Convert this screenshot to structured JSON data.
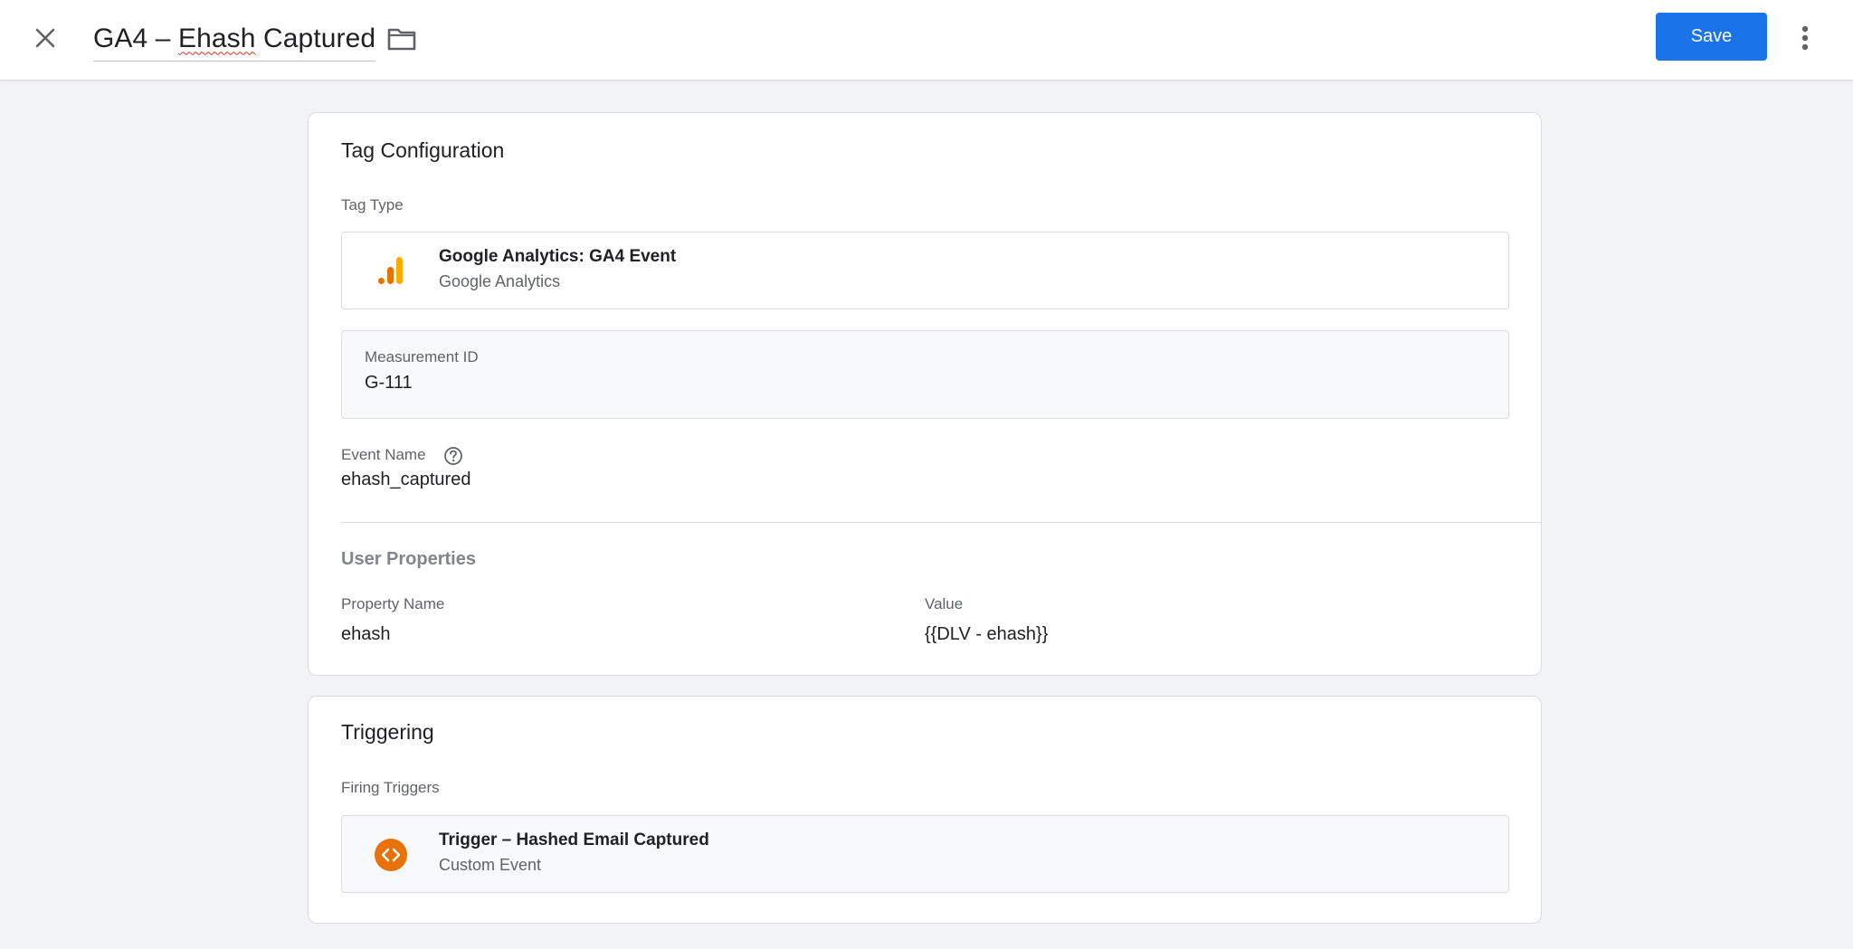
{
  "header": {
    "title_prefix": "GA4 – ",
    "title_misspelled": "Ehash",
    "title_suffix": " Captured",
    "save_label": "Save",
    "icons": [
      "close-icon",
      "folder-icon",
      "more-vert-icon"
    ],
    "accent_color": "#1a73e8"
  },
  "tag_configuration": {
    "title": "Tag Configuration",
    "tag_type_label": "Tag Type",
    "tag_type": {
      "name": "Google Analytics: GA4 Event",
      "provider": "Google Analytics",
      "icon": "google-analytics-icon"
    },
    "measurement_id": {
      "label": "Measurement ID",
      "value": "G-111"
    },
    "event_name": {
      "label": "Event Name",
      "value": "ehash_captured",
      "help_icon": "help-icon"
    },
    "user_properties": {
      "title": "User Properties",
      "property_name_label": "Property Name",
      "value_label": "Value",
      "rows": [
        {
          "property_name": "ehash",
          "value": "{{DLV - ehash}}"
        }
      ]
    }
  },
  "triggering": {
    "title": "Triggering",
    "firing_triggers_label": "Firing Triggers",
    "triggers": [
      {
        "name": "Trigger – Hashed Email Captured",
        "type": "Custom Event",
        "icon": "custom-event-icon",
        "icon_color": "#e8710a"
      }
    ]
  }
}
